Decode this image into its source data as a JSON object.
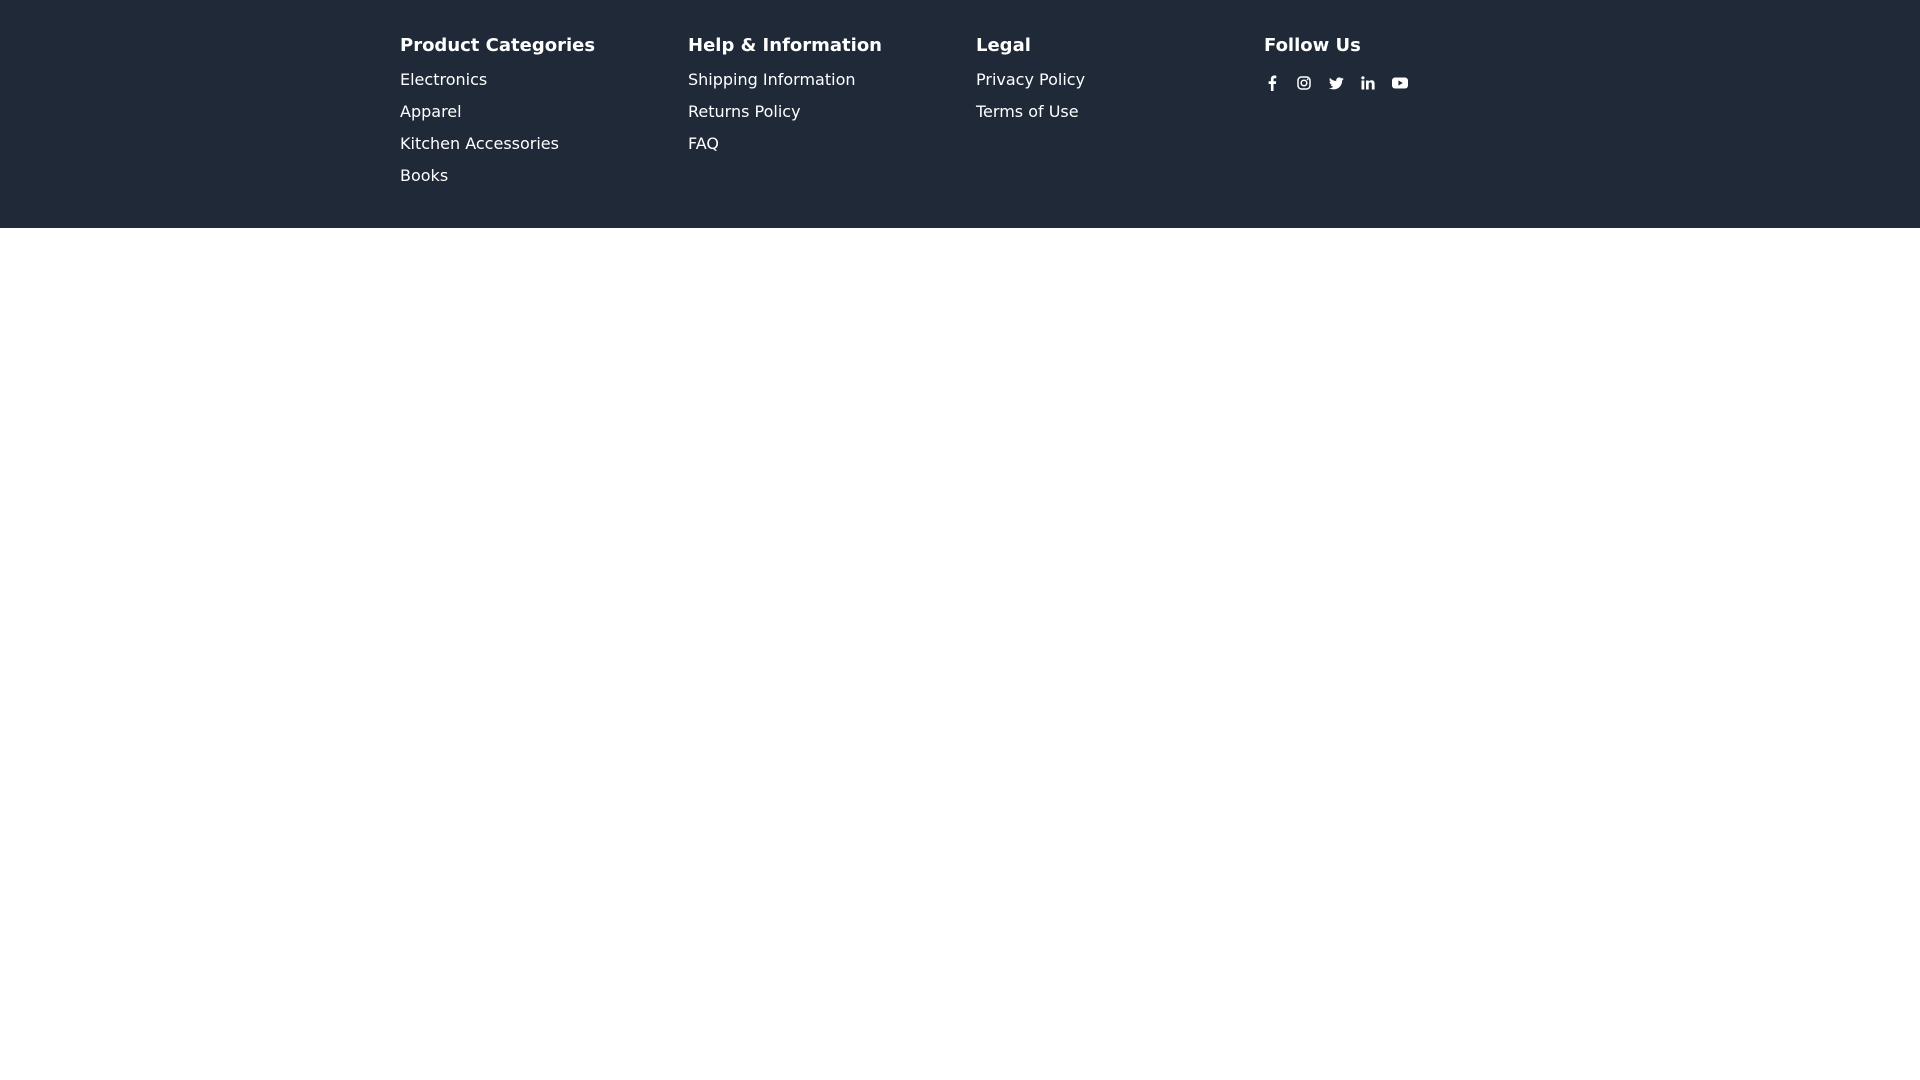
{
  "footer": {
    "columns": [
      {
        "heading": "Product Categories",
        "links": [
          "Electronics",
          "Apparel",
          "Kitchen Accessories",
          "Books"
        ]
      },
      {
        "heading": "Help & Information",
        "links": [
          "Shipping Information",
          "Returns Policy",
          "FAQ"
        ]
      },
      {
        "heading": "Legal",
        "links": [
          "Privacy Policy",
          "Terms of Use"
        ]
      }
    ],
    "follow": {
      "heading": "Follow Us",
      "icons": [
        "facebook-icon",
        "instagram-icon",
        "twitter-icon",
        "linkedin-icon",
        "youtube-icon"
      ]
    },
    "colors": {
      "background": "#1f2937",
      "text": "#ffffff"
    }
  }
}
